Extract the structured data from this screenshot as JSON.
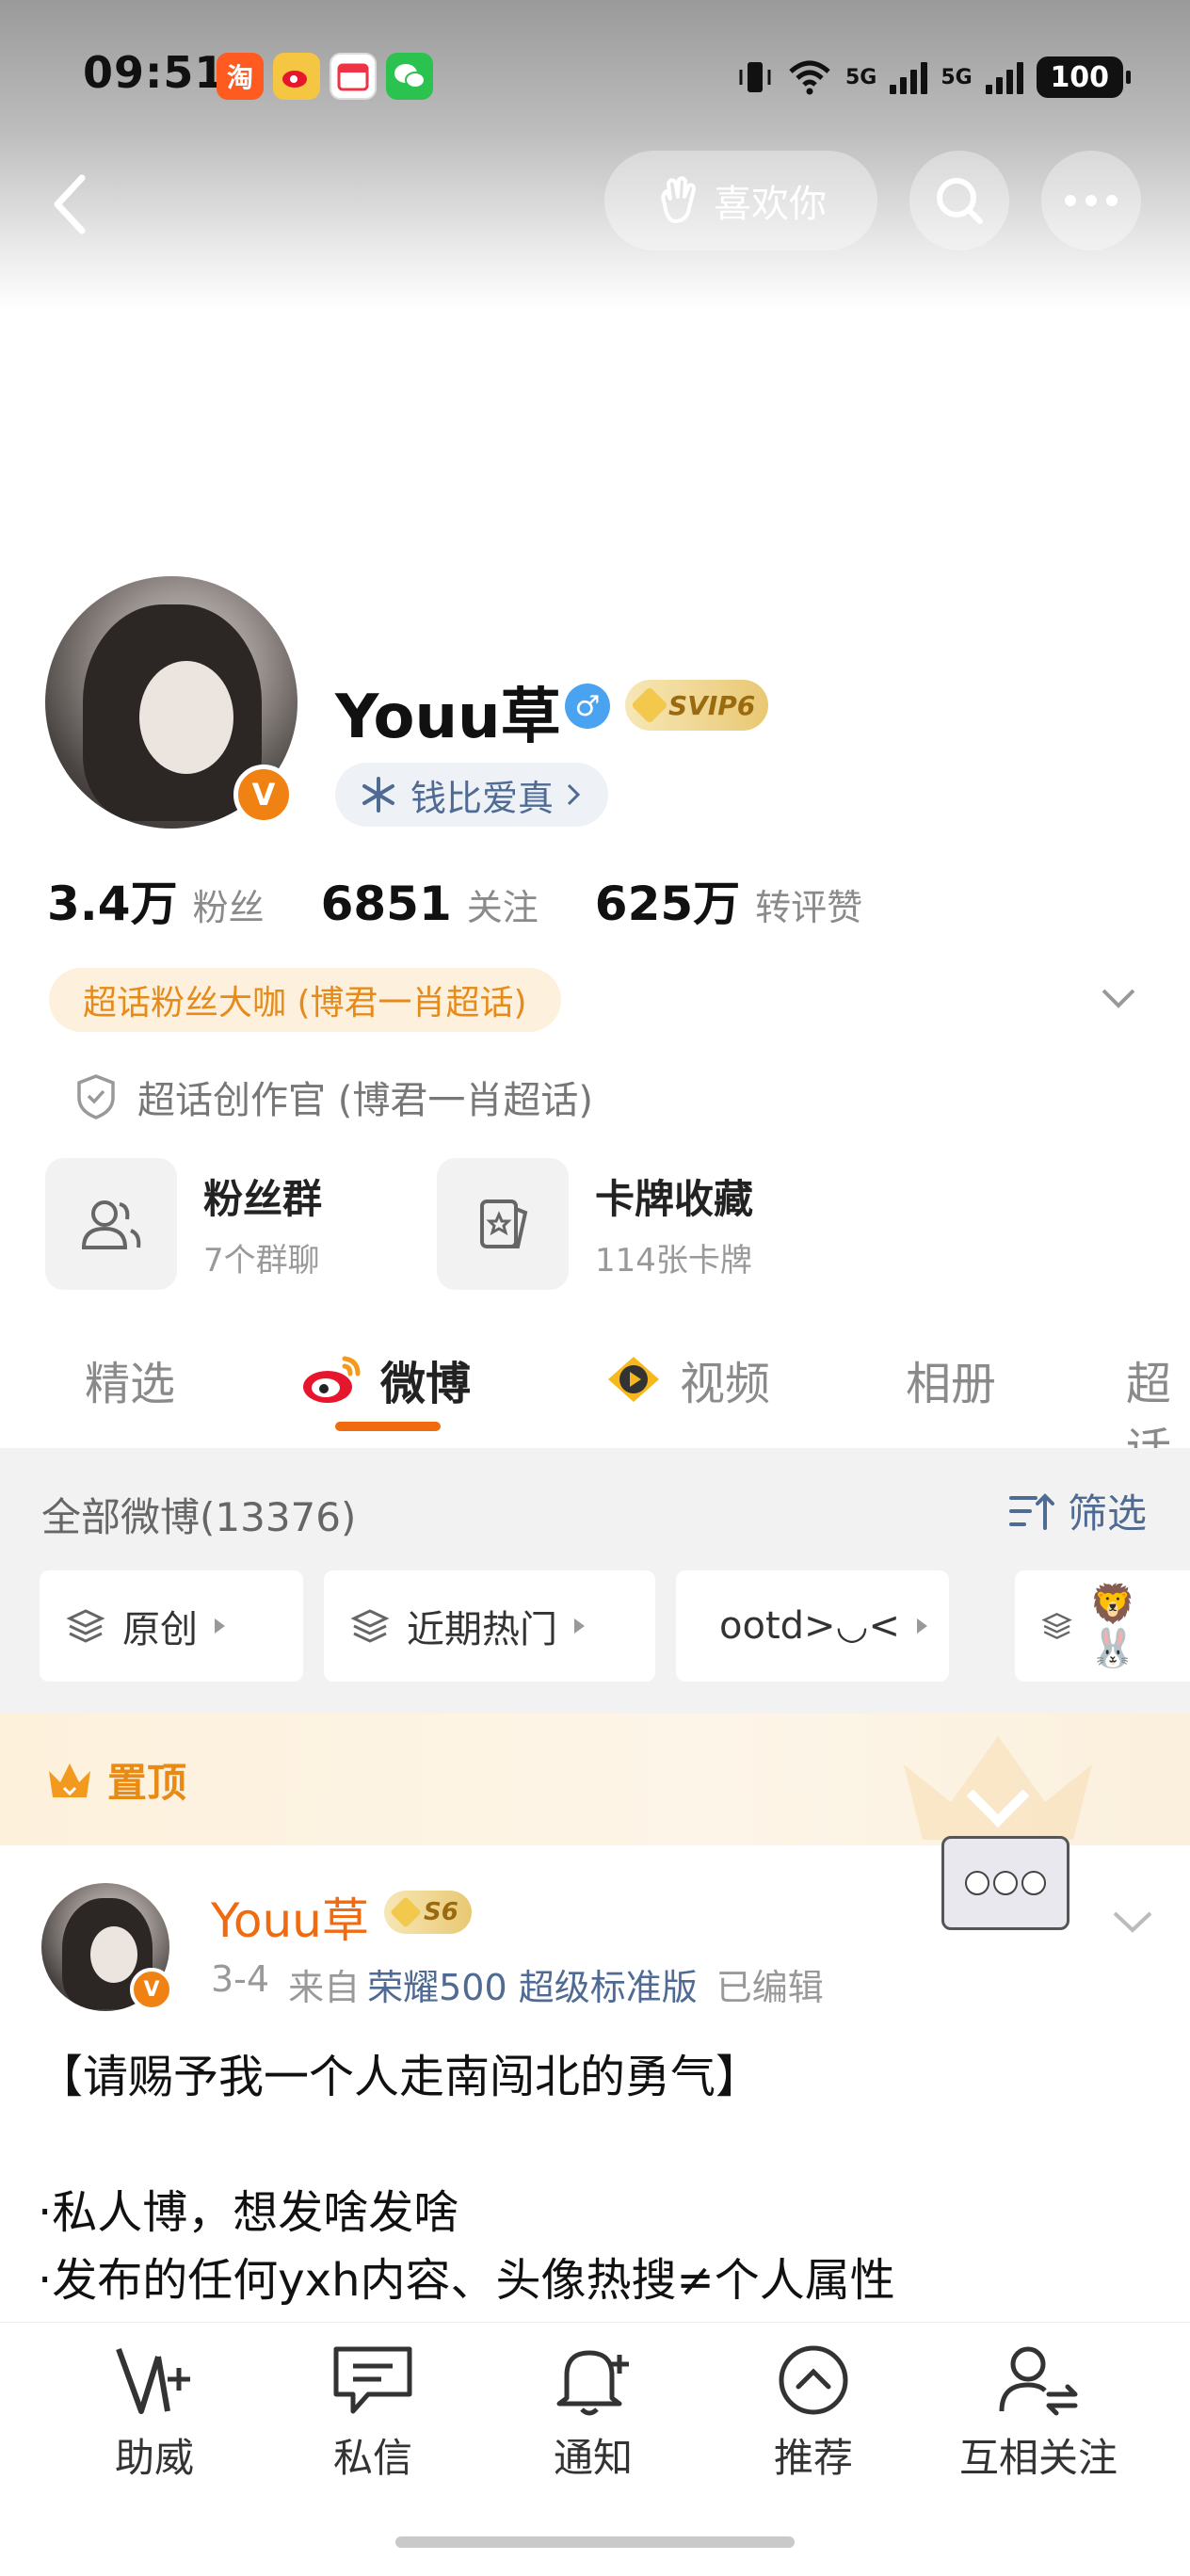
{
  "status": {
    "time": "09:51",
    "net1": "5G",
    "net2": "5G",
    "battery": "100"
  },
  "header": {
    "like_label": "喜欢你"
  },
  "profile": {
    "name": "Youu草",
    "verified_mark": "V",
    "gender_mark": "♂",
    "vip_badge": "SVIP6",
    "signature": "钱比爱真",
    "stats": [
      {
        "num": "3.4万",
        "label": "粉丝"
      },
      {
        "num": "6851",
        "label": "关注"
      },
      {
        "num": "625万",
        "label": "转评赞"
      }
    ],
    "fan_tag": "超话粉丝大咖 (博君一肖超话)",
    "creator_title": "超话创作官 (博君一肖超话)",
    "features": [
      {
        "title": "粉丝群",
        "sub": "7个群聊"
      },
      {
        "title": "卡牌收藏",
        "sub": "114张卡牌"
      }
    ]
  },
  "tabs": [
    {
      "label": "精选"
    },
    {
      "label": "微博"
    },
    {
      "label": "视频"
    },
    {
      "label": "相册"
    },
    {
      "label": "超话"
    }
  ],
  "filter": {
    "all_count": "全部微博(13376)",
    "filter_label": "筛选",
    "chips": [
      {
        "label": "原创"
      },
      {
        "label": "近期热门"
      },
      {
        "label": "ootd>◡<"
      },
      {
        "label": "🦁🐰"
      }
    ]
  },
  "pinned": {
    "label": "置顶",
    "post": {
      "author": "Youu草",
      "level": "S6",
      "date": "3-4",
      "from_label": "来自",
      "source": "荣耀500 超级标准版",
      "edited": "已编辑",
      "lines": [
        "【请赐予我一个人走南闯北的勇气】",
        "",
        "·私人博，想发啥发啥",
        "·发布的任何yxh内容、头像热搜≠个人属性"
      ]
    }
  },
  "bottom_nav": [
    {
      "label": "助威",
      "icon": "cheer-icon"
    },
    {
      "label": "私信",
      "icon": "message-icon"
    },
    {
      "label": "通知",
      "icon": "bell-icon"
    },
    {
      "label": "推荐",
      "icon": "recommend-icon"
    },
    {
      "label": "互相关注",
      "icon": "mutual-follow-icon"
    }
  ],
  "colors": {
    "accent": "#f06a0f",
    "link": "#4f6a93",
    "fan_tag_bg": "#fdf1de"
  }
}
